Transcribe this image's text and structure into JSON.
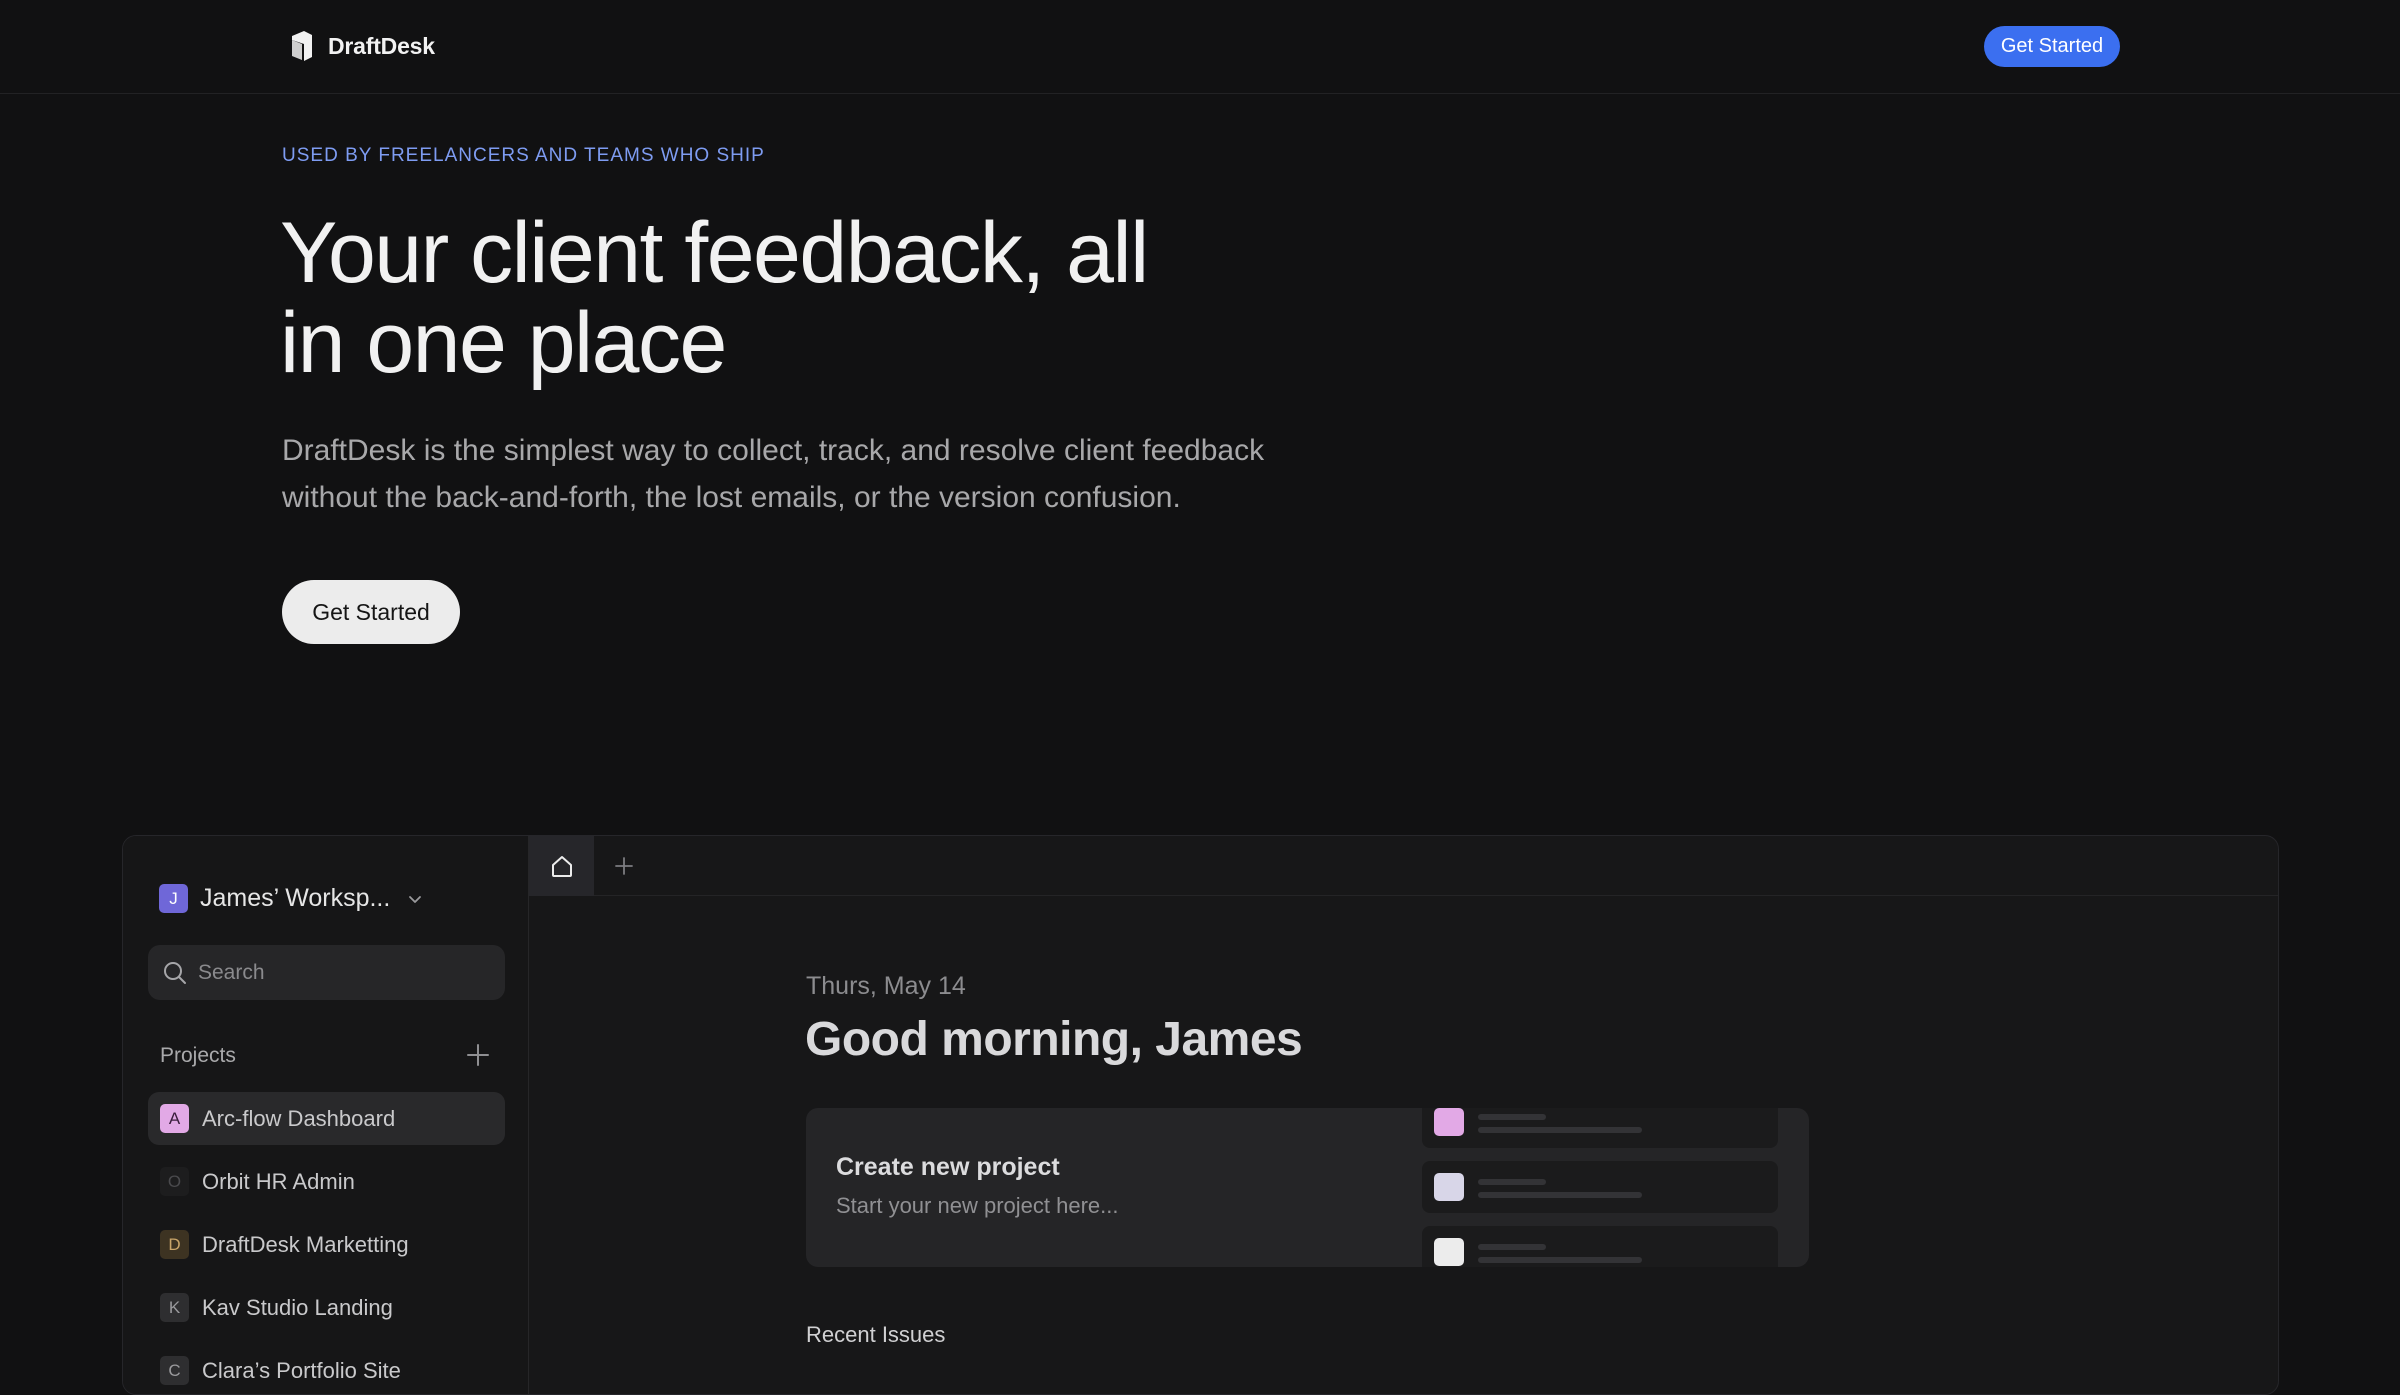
{
  "nav": {
    "brand": "DraftDesk",
    "cta_label": "Get Started"
  },
  "hero": {
    "eyebrow": "USED BY FREELANCERS AND TEAMS WHO SHIP",
    "headline_line1": "Your client feedback, all",
    "headline_line2": "in one place",
    "subtitle_line1": "DraftDesk is the simplest way to collect, track, and resolve client feedback",
    "subtitle_line2": "without the back-and-forth, the lost emails, or the version confusion.",
    "cta_label": "Get Started"
  },
  "app": {
    "workspace": {
      "initial": "J",
      "name": "James’ Worksp..."
    },
    "search": {
      "placeholder": "Search",
      "value": ""
    },
    "projects_label": "Projects",
    "projects": [
      {
        "initial": "A",
        "label": "Arc-flow Dashboard",
        "active": true,
        "badge_bg": "#e2a9e6",
        "badge_fg": "#3a1e3c"
      },
      {
        "initial": "O",
        "label": "Orbit HR Admin",
        "active": false,
        "badge_bg": "#1d1d1e",
        "badge_fg": "#4a4a4d"
      },
      {
        "initial": "D",
        "label": "DraftDesk Marketting",
        "active": false,
        "badge_bg": "#3d3322",
        "badge_fg": "#c9a56a"
      },
      {
        "initial": "K",
        "label": "Kav Studio Landing",
        "active": false,
        "badge_bg": "#2e2e30",
        "badge_fg": "#9a9a9d"
      },
      {
        "initial": "C",
        "label": "Clara’s Portfolio Site",
        "active": false,
        "badge_bg": "#2e2e30",
        "badge_fg": "#9a9a9d"
      }
    ],
    "date": "Thurs, May 14",
    "greeting": "Good morning, James",
    "card": {
      "title": "Create new project",
      "subtitle": "Start your new project here..."
    },
    "mini_swatches": [
      "#e2a9e6",
      "#d8d6e8",
      "#ececec"
    ],
    "recent_label": "Recent Issues"
  }
}
